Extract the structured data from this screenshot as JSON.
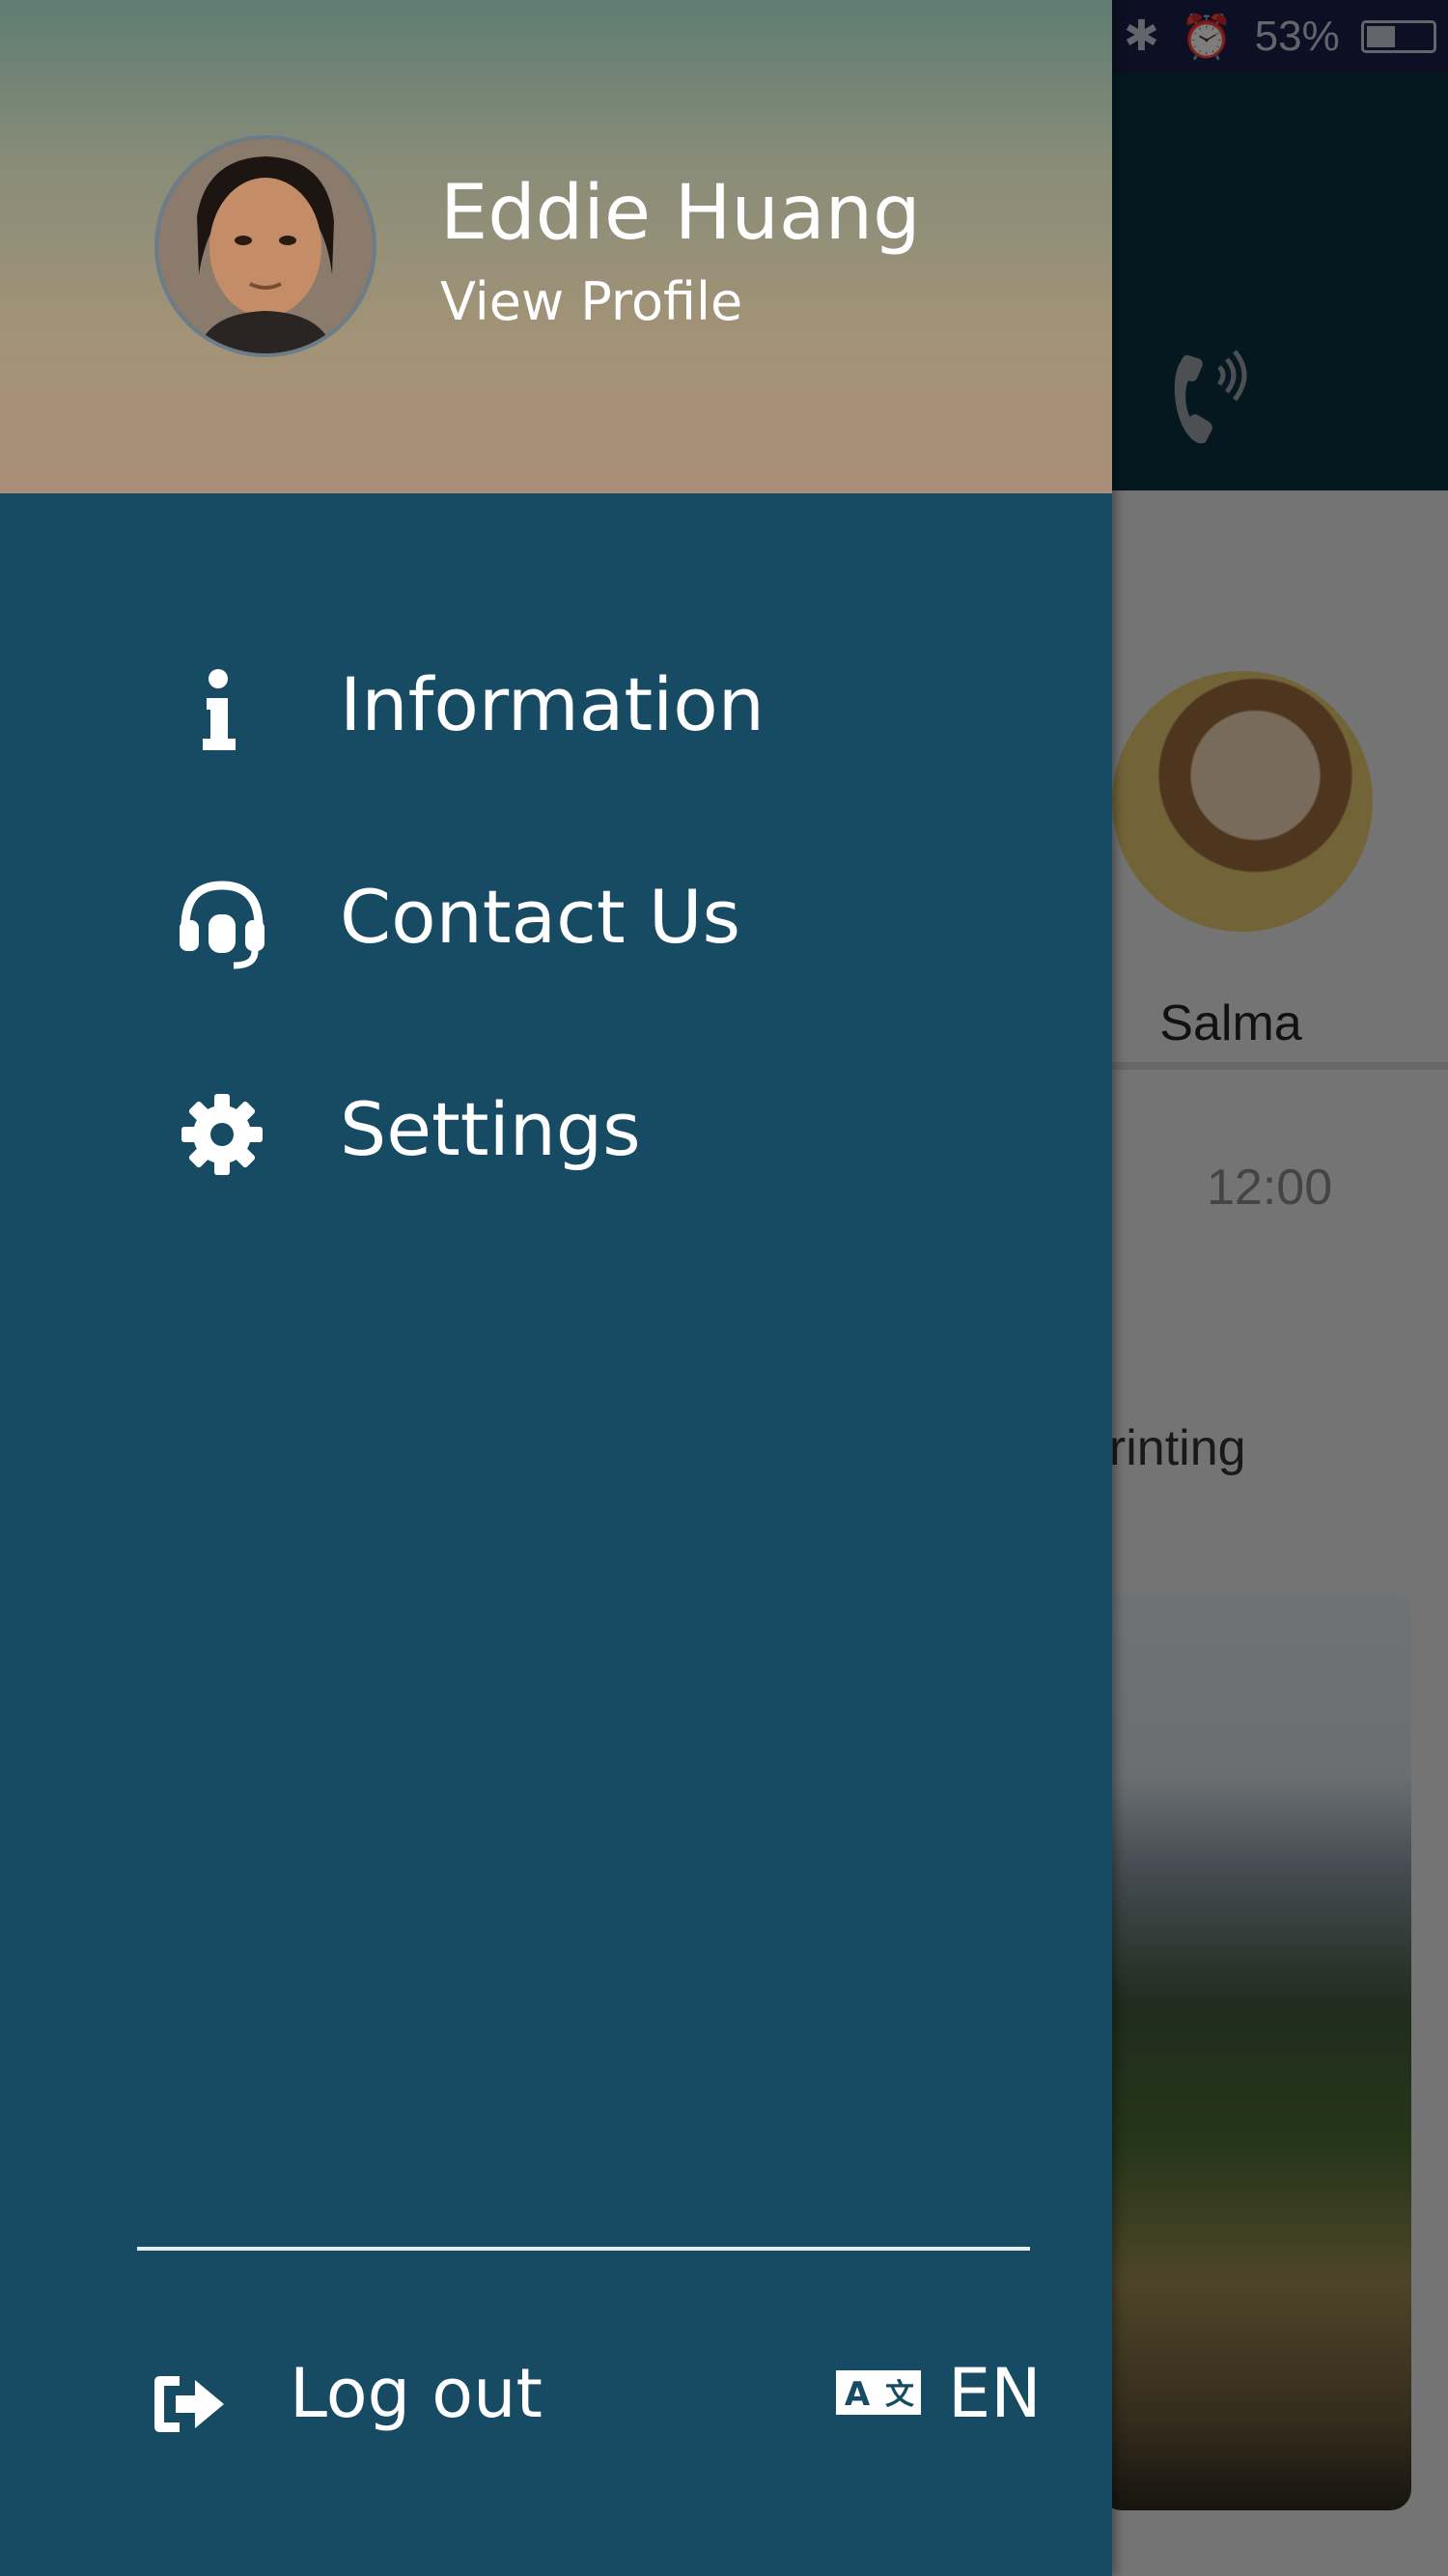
{
  "status_bar": {
    "battery_percent": "53%",
    "icons": [
      "bluetooth-icon",
      "alarm-icon",
      "battery-icon"
    ]
  },
  "drawer": {
    "user": {
      "name": "Eddie Huang",
      "view_profile_label": "View Profile"
    },
    "menu": [
      {
        "label": "Information",
        "icon": "info-icon"
      },
      {
        "label": "Contact Us",
        "icon": "headset-icon"
      },
      {
        "label": "Settings",
        "icon": "gear-icon"
      }
    ],
    "footer": {
      "logout_label": "Log out",
      "language_label": "EN"
    }
  },
  "background_screen": {
    "contact_name": "Salma",
    "time": "12:00",
    "message_snippet": "printing"
  },
  "colors": {
    "drawer_background": "#164b63",
    "header_gradient_top": "#5f7d73",
    "header_gradient_bottom": "#a88e78",
    "text": "#ffffff"
  }
}
